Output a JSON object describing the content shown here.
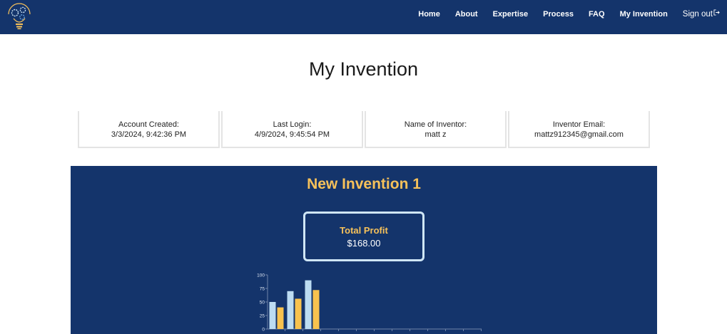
{
  "nav": {
    "links": [
      {
        "label": "Home"
      },
      {
        "label": "About"
      },
      {
        "label": "Expertise"
      },
      {
        "label": "Process"
      },
      {
        "label": "FAQ"
      },
      {
        "label": "My Invention"
      }
    ],
    "signout_label": "Sign out"
  },
  "page": {
    "title": "My Invention"
  },
  "info_cards": [
    {
      "label": "Account Created:",
      "value": "3/3/2024, 9:42:36 PM"
    },
    {
      "label": "Last Login:",
      "value": "4/9/2024, 9:45:54 PM"
    },
    {
      "label": "Name of Inventor:",
      "value": "matt z"
    },
    {
      "label": "Inventor Email:",
      "value": "mattz912345@gmail.com"
    }
  ],
  "invention": {
    "name": "New Invention 1",
    "profit_label": "Total Profit",
    "profit_value": "$168.00"
  },
  "colors": {
    "navy": "#14346b",
    "gold": "#f6c15a",
    "light_blue": "#bcdcf2",
    "bar_gold": "#f8c24e"
  },
  "chart_data": {
    "type": "bar",
    "ylim": [
      0,
      100
    ],
    "yticks": [
      0,
      25,
      50,
      75,
      100
    ],
    "category_count": 12,
    "series": [
      {
        "values": [
          50,
          70,
          90,
          null,
          null,
          null,
          null,
          null,
          null,
          null,
          null,
          null
        ]
      },
      {
        "values": [
          40,
          56,
          72,
          null,
          null,
          null,
          null,
          null,
          null,
          null,
          null,
          null
        ]
      }
    ]
  }
}
